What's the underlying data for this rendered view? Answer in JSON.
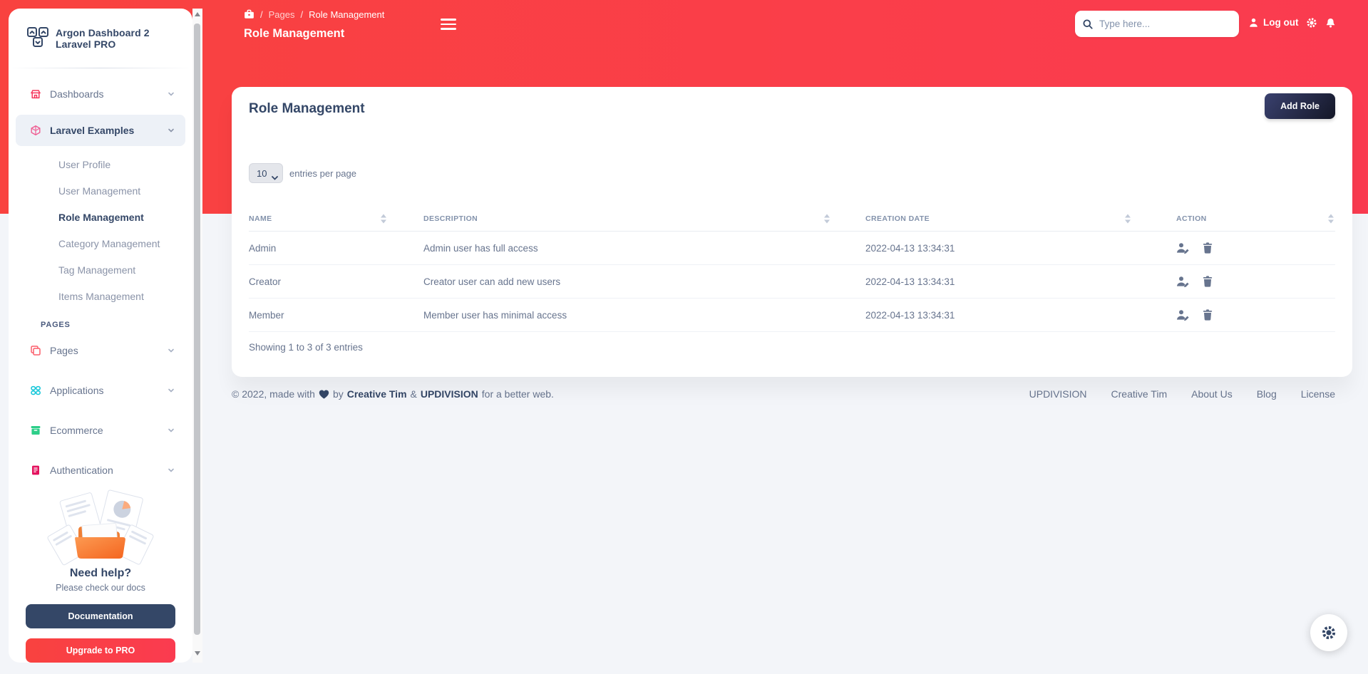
{
  "brand": {
    "title": "Argon Dashboard 2 Laravel PRO"
  },
  "sidebar": {
    "items": [
      {
        "label": "Dashboards",
        "icon": "shop-icon",
        "icon_color": "#f5365c"
      },
      {
        "label": "Laravel Examples",
        "icon": "laravel-icon",
        "icon_color": "#ef5d92",
        "active": true
      }
    ],
    "sub_items": [
      "User Profile",
      "User Management",
      "Role Management",
      "Category Management",
      "Tag Management",
      "Items Management"
    ],
    "active_sub_item": "Role Management",
    "section_label": "PAGES",
    "items2": [
      {
        "label": "Pages",
        "icon": "copy-icon",
        "icon_color": "#fb5d6a"
      },
      {
        "label": "Applications",
        "icon": "apps-icon",
        "icon_color": "#0dc5d8"
      },
      {
        "label": "Ecommerce",
        "icon": "box-icon",
        "icon_color": "#2dce89"
      },
      {
        "label": "Authentication",
        "icon": "document-icon",
        "icon_color": "#e4125e"
      }
    ],
    "help": {
      "title": "Need help?",
      "subtitle": "Please check our docs",
      "doc_button": "Documentation",
      "upgrade_button": "Upgrade to PRO"
    }
  },
  "navbar": {
    "breadcrumb": {
      "root": "Pages",
      "current": "Role Management",
      "sep": "/"
    },
    "page_title": "Role Management",
    "search": {
      "placeholder": "Type here..."
    },
    "logout_label": "Log out"
  },
  "main": {
    "card_title": "Role Management",
    "add_button": "Add Role",
    "entries": {
      "selected": "10",
      "suffix": "entries per page"
    },
    "table": {
      "columns": [
        "NAME",
        "DESCRIPTION",
        "CREATION DATE",
        "ACTION"
      ],
      "rows": [
        {
          "name": "Admin",
          "description": "Admin user has full access",
          "created": "2022-04-13 13:34:31"
        },
        {
          "name": "Creator",
          "description": "Creator user can add new users",
          "created": "2022-04-13 13:34:31"
        },
        {
          "name": "Member",
          "description": "Member user has minimal access",
          "created": "2022-04-13 13:34:31"
        }
      ]
    },
    "showing_text": "Showing 1 to 3 of 3 entries"
  },
  "footer": {
    "left": {
      "prefix": "© 2022, made with",
      "by": "by",
      "brand1": "Creative Tim",
      "amp": "&",
      "brand2": "UPDIVISION",
      "suffix": "for a better web."
    },
    "links": [
      "UPDIVISION",
      "Creative Tim",
      "About Us",
      "Blog",
      "License"
    ]
  },
  "icons": {
    "search-icon": "magnifier",
    "user-icon": "person silhouette",
    "gear-icon": "cog",
    "bell-icon": "notification bell",
    "hamburger-icon": "three bars",
    "home-icon": "briefcase/shop",
    "heart-icon": "♥",
    "edit-user-icon": "person with pen",
    "trash-icon": "trash can",
    "chevron-down-icon": "˅",
    "sort-icon": "▲▼"
  },
  "colors": {
    "header_red": "#f9423f",
    "navy": "#344767",
    "text_muted": "#67748e",
    "table_header_muted": "#8392ab",
    "active_item_bg": "#edf1f7",
    "cyan": "#0dc5d8",
    "green": "#2dce89",
    "pink": "#e4125e",
    "orange_folder": "#f4751f"
  }
}
